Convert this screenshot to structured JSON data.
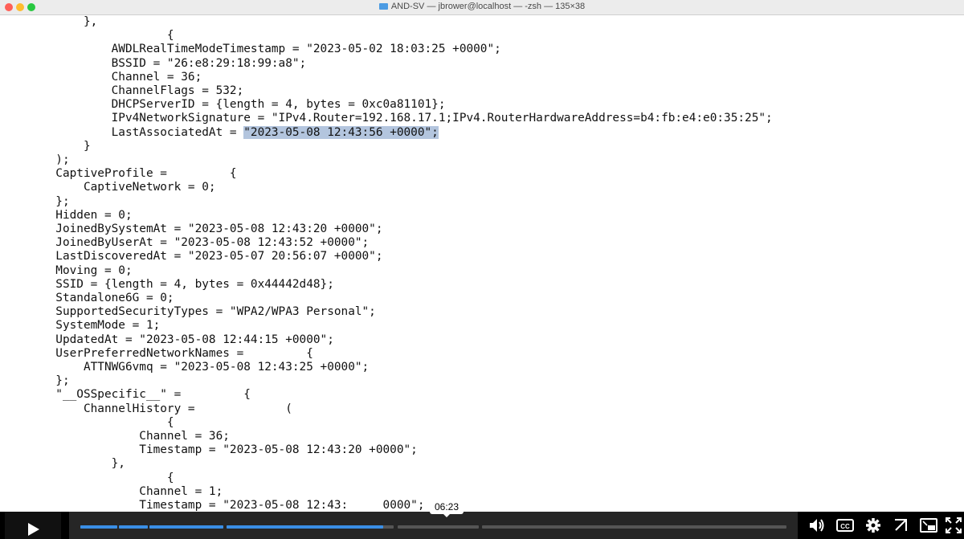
{
  "window": {
    "title": "AND-SV — jbrower@localhost — -zsh — 135×38"
  },
  "terminal": {
    "lines": [
      "            },",
      "                        {",
      "                AWDLRealTimeModeTimestamp = \"2023-05-02 18:03:25 +0000\";",
      "                BSSID = \"26:e8:29:18:99:a8\";",
      "                Channel = 36;",
      "                ChannelFlags = 532;",
      "                DHCPServerID = {length = 4, bytes = 0xc0a81101};",
      "                IPv4NetworkSignature = \"IPv4.Router=192.168.17.1;IPv4.RouterHardwareAddress=b4:fb:e4:e0:35:25\";",
      "                LastAssociatedAt = \"2023-05-08 12:43:56 +0000\";",
      "            }",
      "        );",
      "        CaptiveProfile =         {",
      "            CaptiveNetwork = 0;",
      "        };",
      "        Hidden = 0;",
      "        JoinedBySystemAt = \"2023-05-08 12:43:20 +0000\";",
      "        JoinedByUserAt = \"2023-05-08 12:43:52 +0000\";",
      "        LastDiscoveredAt = \"2023-05-07 20:56:07 +0000\";",
      "        Moving = 0;",
      "        SSID = {length = 4, bytes = 0x44442d48};",
      "        Standalone6G = 0;",
      "        SupportedSecurityTypes = \"WPA2/WPA3 Personal\";",
      "        SystemMode = 1;",
      "        UpdatedAt = \"2023-05-08 12:44:15 +0000\";",
      "        UserPreferredNetworkNames =         {",
      "            ATTNWG6vmq = \"2023-05-08 12:43:25 +0000\";",
      "        };",
      "        \"__OSSpecific__\" =         {",
      "            ChannelHistory =             (",
      "                        {",
      "                    Channel = 36;",
      "                    Timestamp = \"2023-05-08 12:43:20 +0000\";",
      "                },",
      "                        {",
      "                    Channel = 1;",
      "                    Timestamp = \"2023-05-08 12:43:"
    ],
    "selected_line_prefix": "                LastAssociatedAt = ",
    "selected_text": "\"2023-05-08 12:43:56 +0000\";",
    "last_line_tail": "0000\";"
  },
  "player": {
    "tooltip_time": "06:23",
    "progress_fraction": 0.42,
    "icons": {
      "play": "play-icon",
      "volume": "volume-icon",
      "captions": "captions-icon",
      "settings": "gear-icon",
      "share": "share-icon",
      "pip": "picture-in-picture-icon",
      "fullscreen": "fullscreen-icon"
    },
    "captions_label": "CC",
    "accent_color": "#3a8ee6"
  }
}
